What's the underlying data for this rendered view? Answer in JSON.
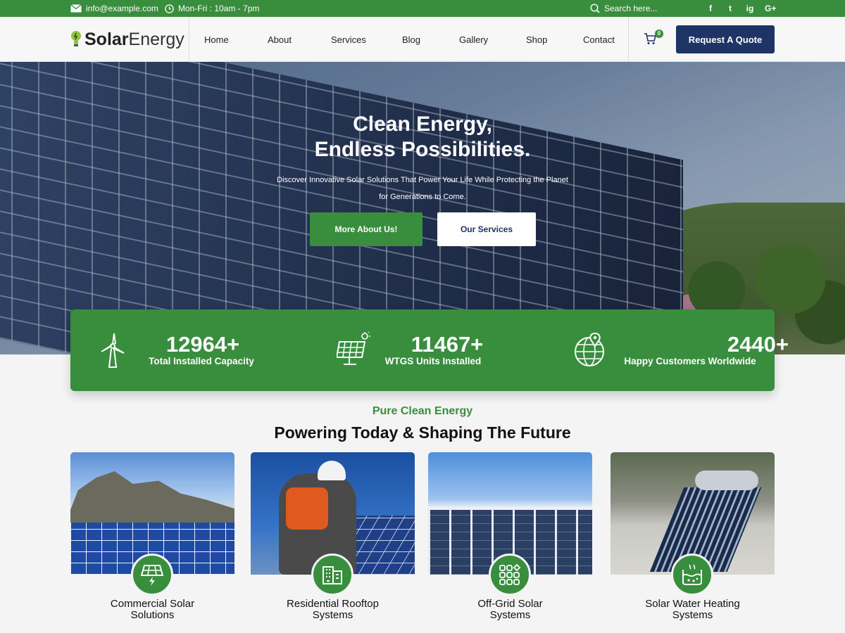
{
  "topbar": {
    "email": "info@example.com",
    "hours": "Mon-Fri : 10am - 7pm",
    "search_placeholder": "Search here...",
    "social": [
      "f",
      "t",
      "ig",
      "G+"
    ]
  },
  "header": {
    "logo_solar": "Solar",
    "logo_energy": "Energy",
    "nav": [
      "Home",
      "About",
      "Services",
      "Blog",
      "Gallery",
      "Shop",
      "Contact"
    ],
    "cart_count": "0",
    "quote_button": "Request A Quote"
  },
  "hero": {
    "title_line1": "Clean Energy,",
    "title_line2": "Endless Possibilities.",
    "subtitle_line1": "Discover Innovative Solar Solutions That Power Your Life While Protecting the Planet",
    "subtitle_line2": "for Generations to Come.",
    "btn_primary": "More About Us!",
    "btn_secondary": "Our Services"
  },
  "stats": [
    {
      "value": "12964+",
      "label": "Total Installed Capacity",
      "icon": "wind-turbine-icon"
    },
    {
      "value": "11467+",
      "label": "WTGS Units Installed",
      "icon": "solar-panel-icon"
    },
    {
      "value": "2440+",
      "label": "Happy Customers Worldwide",
      "icon": "globe-location-icon"
    }
  ],
  "section": {
    "eyebrow": "Pure Clean Energy",
    "title": "Powering Today & Shaping The Future"
  },
  "cards": [
    {
      "line1": "Commercial Solar",
      "line2": "Solutions",
      "icon": "solar-panel-bolt-icon"
    },
    {
      "line1": "Residential Rooftop",
      "line2": "Systems",
      "icon": "building-icon"
    },
    {
      "line1": "Off-Grid Solar",
      "line2": "Systems",
      "icon": "grid-cells-icon"
    },
    {
      "line1": "Solar Water Heating",
      "line2": "Systems",
      "icon": "water-tank-icon"
    }
  ],
  "colors": {
    "brand_green": "#388e3c",
    "navy": "#1f3466",
    "white": "#ffffff"
  }
}
